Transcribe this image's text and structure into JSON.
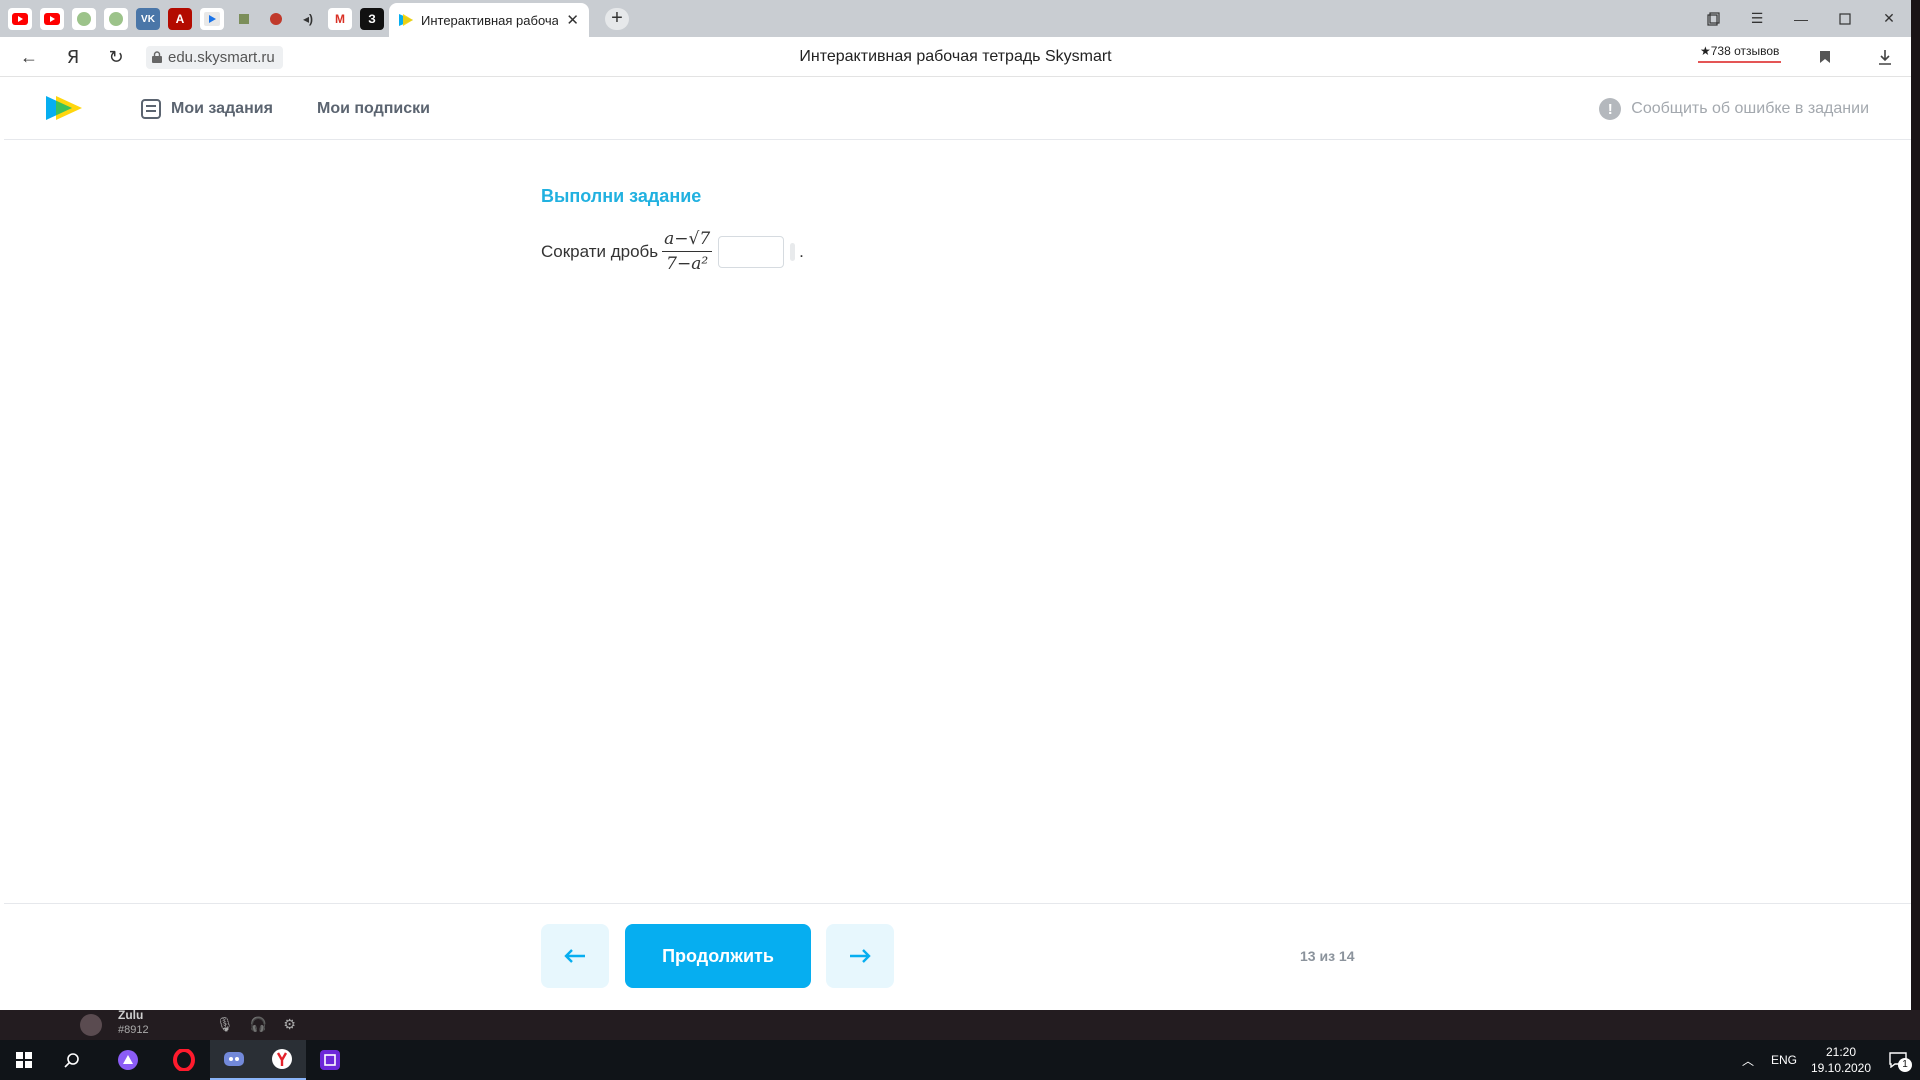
{
  "browser": {
    "active_tab_title": "Интерактивная рабочая тетрадь Skysmart",
    "url": "edu.skysmart.ru",
    "page_title": "Интерактивная рабочая тетрадь Skysmart",
    "reviews_label": "★738 отзывов",
    "pinned_tabs": [
      "youtube-icon",
      "youtube-icon",
      "globe-icon",
      "globe-icon",
      "vk-icon",
      "acrobat-icon",
      "play-icon",
      "app-icon",
      "app-icon",
      "audio-icon",
      "gmail-icon",
      "z-icon"
    ],
    "pinned_labels": {
      "vk": "VK",
      "acrobat": "A",
      "gmail": "M",
      "z": "З"
    }
  },
  "header": {
    "my_tasks": "Мои задания",
    "my_subscriptions": "Мои подписки",
    "report_error": "Сообщить об ошибке в задании"
  },
  "task": {
    "heading": "Выполни задание",
    "prompt": "Сократи дробь",
    "fraction": {
      "numerator": "a−√7",
      "denominator": "7−a²"
    },
    "answer_value": "",
    "trailing_period": "."
  },
  "footer": {
    "continue_label": "Продолжить",
    "counter": "13 из 14"
  },
  "discord": {
    "name": "Zulu",
    "tag": "#8912"
  },
  "taskbar": {
    "lang": "ENG",
    "time": "21:20",
    "date": "19.10.2020",
    "notifications": "1"
  },
  "colors": {
    "accent": "#06aef0",
    "heading": "#21b1e0",
    "arrow_bg": "#e7f7fd"
  }
}
